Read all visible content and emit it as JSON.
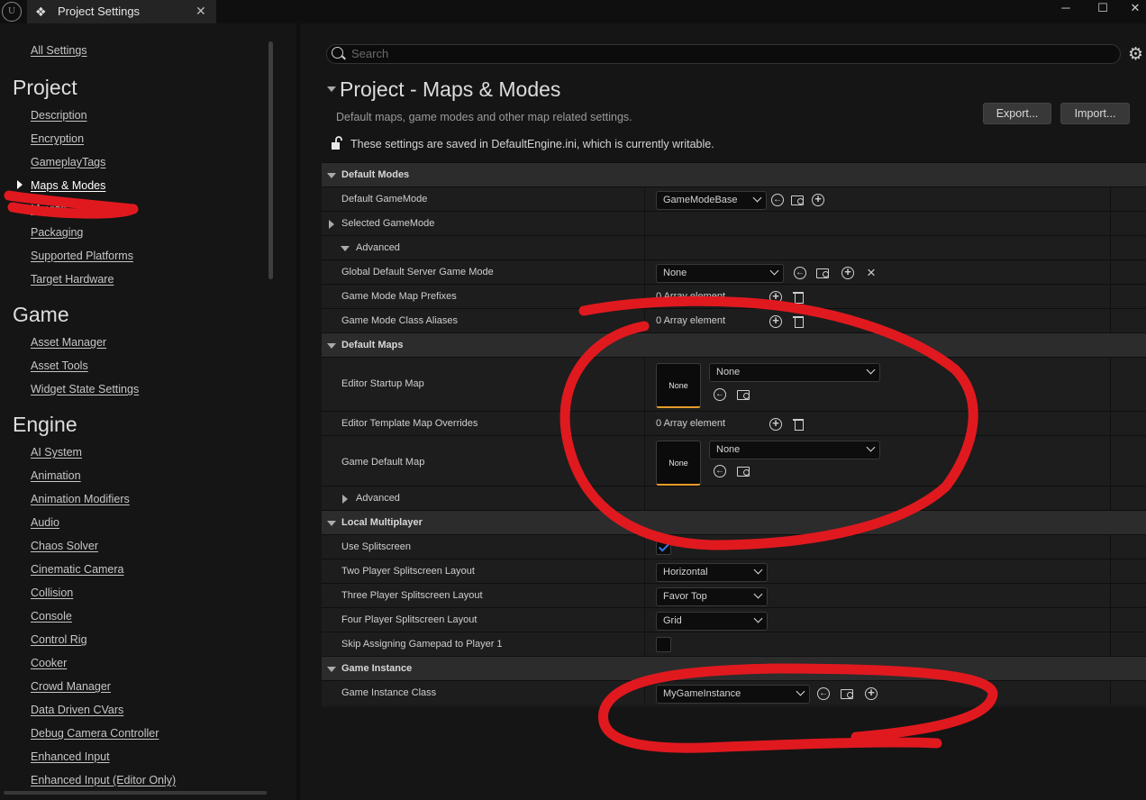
{
  "window": {
    "tab_title": "Project Settings",
    "app_logo": "unreal-engine-logo",
    "controls": [
      "minimize",
      "maximize",
      "close"
    ]
  },
  "sidebar": {
    "all_settings": "All Settings",
    "categories": [
      {
        "title": "Project",
        "items": [
          "Description",
          "Encryption",
          "GameplayTags",
          "Maps & Modes",
          "Movies",
          "Packaging",
          "Supported Platforms",
          "Target Hardware"
        ]
      },
      {
        "title": "Game",
        "items": [
          "Asset Manager",
          "Asset Tools",
          "Widget State Settings"
        ]
      },
      {
        "title": "Engine",
        "items": [
          "AI System",
          "Animation",
          "Animation Modifiers",
          "Audio",
          "Chaos Solver",
          "Cinematic Camera",
          "Collision",
          "Console",
          "Control Rig",
          "Cooker",
          "Crowd Manager",
          "Data Driven CVars",
          "Debug Camera Controller",
          "Enhanced Input",
          "Enhanced Input (Editor Only)"
        ]
      }
    ],
    "selected_item": "Maps & Modes"
  },
  "search": {
    "placeholder": "Search"
  },
  "section": {
    "title": "Project - Maps & Modes",
    "description": "Default maps, game modes and other map related settings.",
    "export_label": "Export...",
    "import_label": "Import...",
    "notice": "These settings are saved in DefaultEngine.ini, which is currently writable."
  },
  "details": {
    "default_modes": {
      "header": "Default Modes",
      "default_gamemode_label": "Default GameMode",
      "default_gamemode_value": "GameModeBase",
      "selected_gamemode_label": "Selected GameMode",
      "advanced_label": "Advanced",
      "global_server_label": "Global Default Server Game Mode",
      "global_server_value": "None",
      "prefixes_label": "Game Mode Map Prefixes",
      "prefixes_value": "0 Array element",
      "aliases_label": "Game Mode Class Aliases",
      "aliases_value": "0 Array element"
    },
    "default_maps": {
      "header": "Default Maps",
      "editor_startup_label": "Editor Startup Map",
      "editor_startup_thumb": "None",
      "editor_startup_value": "None",
      "template_overrides_label": "Editor Template Map Overrides",
      "template_overrides_value": "0 Array element",
      "game_default_label": "Game Default Map",
      "game_default_thumb": "None",
      "game_default_value": "None",
      "advanced_label": "Advanced"
    },
    "local_multiplayer": {
      "header": "Local Multiplayer",
      "use_splitscreen_label": "Use Splitscreen",
      "use_splitscreen_checked": true,
      "two_player_label": "Two Player Splitscreen Layout",
      "two_player_value": "Horizontal",
      "three_player_label": "Three Player Splitscreen Layout",
      "three_player_value": "Favor Top",
      "four_player_label": "Four Player Splitscreen Layout",
      "four_player_value": "Grid",
      "skip_gamepad_label": "Skip Assigning Gamepad to Player 1",
      "skip_gamepad_checked": false
    },
    "game_instance": {
      "header": "Game Instance",
      "class_label": "Game Instance Class",
      "class_value": "MyGameInstance"
    }
  },
  "annotation_color": "#e0191f"
}
